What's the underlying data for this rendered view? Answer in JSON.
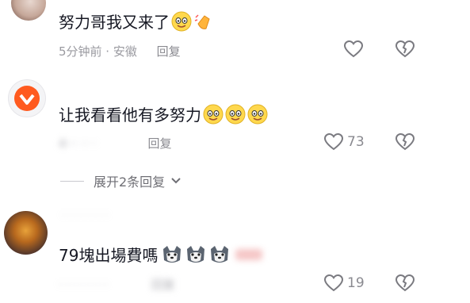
{
  "comments": [
    {
      "text": "努力哥我又来了",
      "time_location": "5分钟前 · 安徽",
      "reply_label": "回复",
      "like_count": ""
    },
    {
      "text": "让我看看他有多努力",
      "time_location": "4··· ·· ·",
      "reply_label": "回复",
      "like_count": "73",
      "expand_label": "展开2条回复"
    },
    {
      "username": "· · · · · · ·",
      "text": "79塊出場費嗎",
      "time_location": "· · · · · · ·",
      "reply_label": "回复",
      "like_count": "19"
    }
  ],
  "icons": {
    "like": "heart-outline-icon",
    "dislike": "broken-heart-icon",
    "expand": "chevron-down-icon"
  }
}
